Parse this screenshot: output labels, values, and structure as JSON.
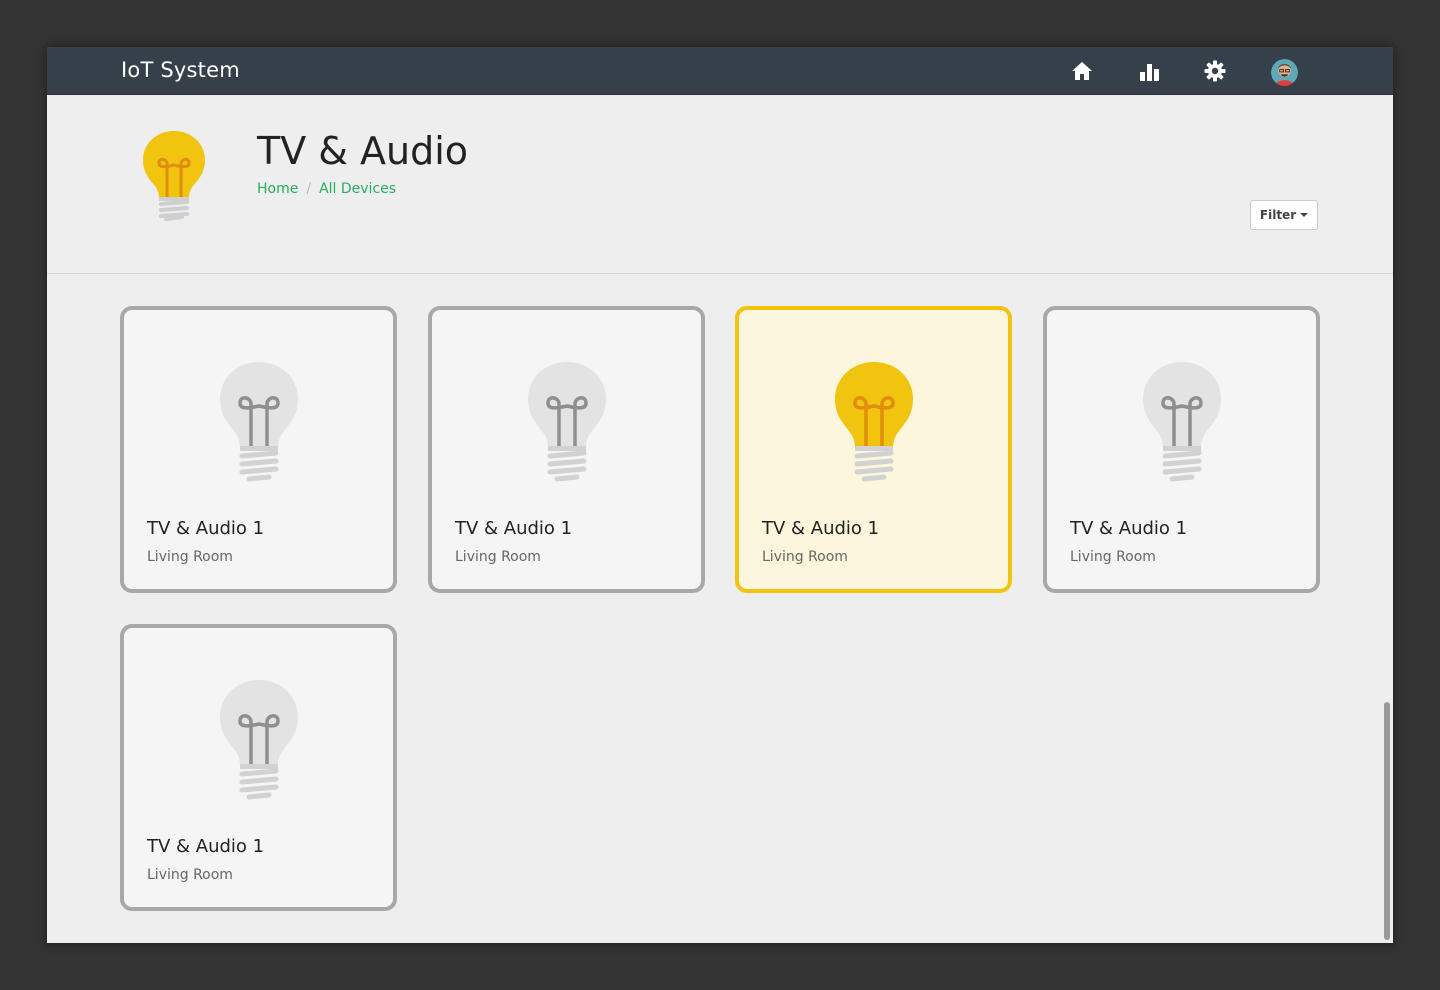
{
  "app": {
    "title": "IoT System"
  },
  "nav": [
    {
      "name": "home-icon",
      "label": "Home"
    },
    {
      "name": "stats-icon",
      "label": "Stats"
    },
    {
      "name": "gear-icon",
      "label": "Settings"
    }
  ],
  "header": {
    "title": "TV & Audio",
    "breadcrumb": [
      "Home",
      "All Devices"
    ],
    "filter_label": "Filter"
  },
  "colors": {
    "topbar": "#36404a",
    "accent_on": "#f1c40f",
    "card_border_off": "#a8a8a8",
    "breadcrumb": "#27ae60"
  },
  "devices": [
    {
      "name": "TV & Audio 1",
      "room": "Living Room",
      "state": "off"
    },
    {
      "name": "TV & Audio 1",
      "room": "Living Room",
      "state": "off"
    },
    {
      "name": "TV & Audio 1",
      "room": "Living Room",
      "state": "on"
    },
    {
      "name": "TV & Audio 1",
      "room": "Living Room",
      "state": "off"
    },
    {
      "name": "TV & Audio 1",
      "room": "Living Room",
      "state": "off"
    }
  ]
}
